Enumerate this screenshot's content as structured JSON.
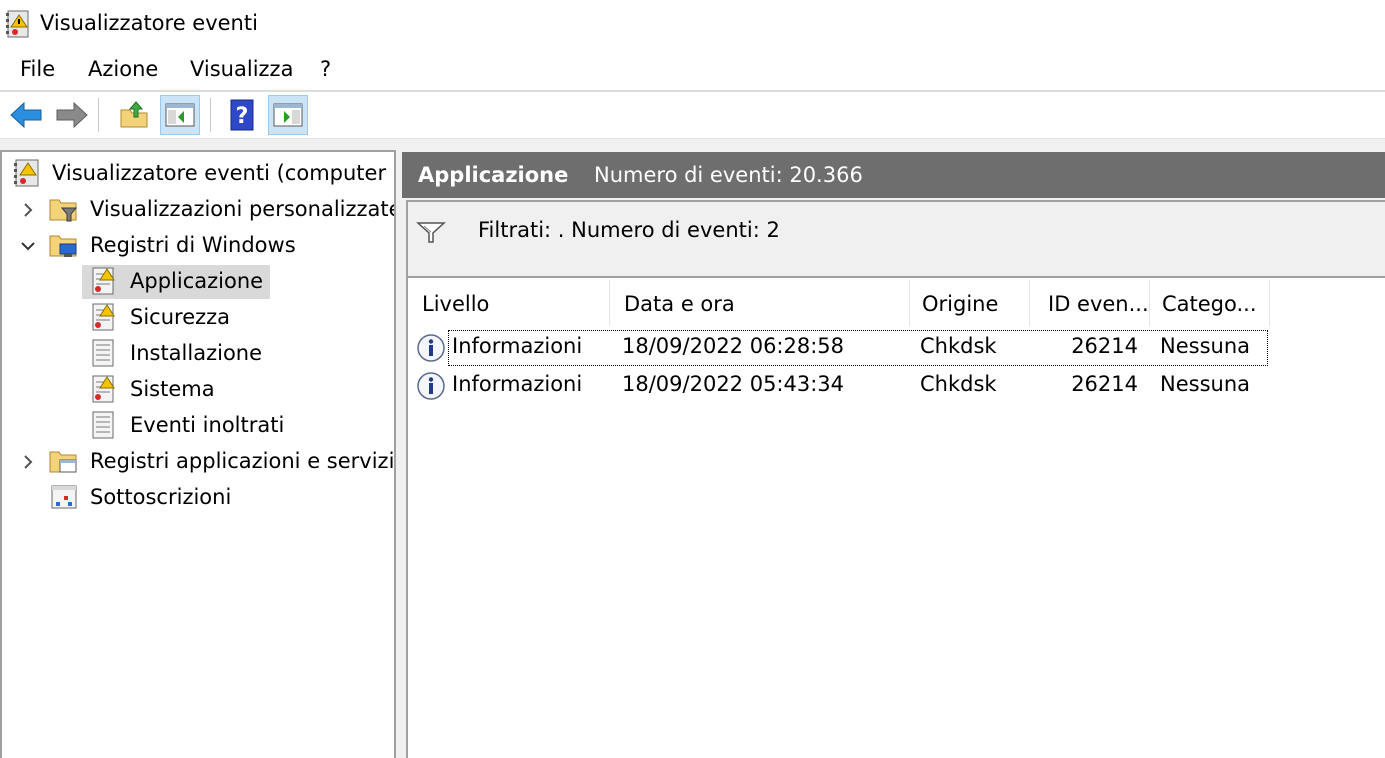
{
  "window": {
    "title": "Visualizzatore eventi"
  },
  "menu": [
    {
      "label": "File"
    },
    {
      "label": "Azione"
    },
    {
      "label": "Visualizza"
    },
    {
      "label": "?"
    }
  ],
  "toolbar": {
    "buttons": [
      {
        "name": "back-button",
        "icon": "arrow-left-icon"
      },
      {
        "name": "forward-button",
        "icon": "arrow-right-icon"
      },
      {
        "name": "up-folder-button",
        "icon": "folder-up-icon"
      },
      {
        "name": "show-hide-tree-button",
        "icon": "console-tree-icon",
        "pressed": true
      },
      {
        "name": "help-button",
        "icon": "help-icon"
      },
      {
        "name": "show-hide-action-pane-button",
        "icon": "action-pane-icon",
        "pressed": true
      }
    ]
  },
  "tree": {
    "root": {
      "label": "Visualizzatore eventi (computer lo"
    },
    "items": [
      {
        "label": "Visualizzazioni personalizzate",
        "expander": "collapsed"
      },
      {
        "label": "Registri di Windows",
        "expander": "expanded"
      },
      {
        "label": "Applicazione",
        "selected": true
      },
      {
        "label": "Sicurezza"
      },
      {
        "label": "Installazione"
      },
      {
        "label": "Sistema"
      },
      {
        "label": "Eventi inoltrati"
      },
      {
        "label": "Registri applicazioni e servizi",
        "expander": "collapsed"
      },
      {
        "label": "Sottoscrizioni"
      }
    ]
  },
  "log": {
    "title": "Applicazione",
    "count_text": "Numero di eventi: 20.366",
    "filter_text": "Filtrati: . Numero di eventi: 2"
  },
  "grid": {
    "columns": [
      "Livello",
      "Data e ora",
      "Origine",
      "ID even...",
      "Catego..."
    ],
    "rows": [
      {
        "level": "Informazioni",
        "datetime": "18/09/2022 06:28:58",
        "source": "Chkdsk",
        "id": "26214",
        "category": "Nessuna",
        "focused": true
      },
      {
        "level": "Informazioni",
        "datetime": "18/09/2022 05:43:34",
        "source": "Chkdsk",
        "id": "26214",
        "category": "Nessuna",
        "focused": false
      }
    ]
  },
  "colors": {
    "header_bg": "#6e6e6e",
    "selection_bg": "#d9d9d9",
    "pressed_bg": "#cce4f7",
    "pane_border": "#a0a0a0"
  }
}
